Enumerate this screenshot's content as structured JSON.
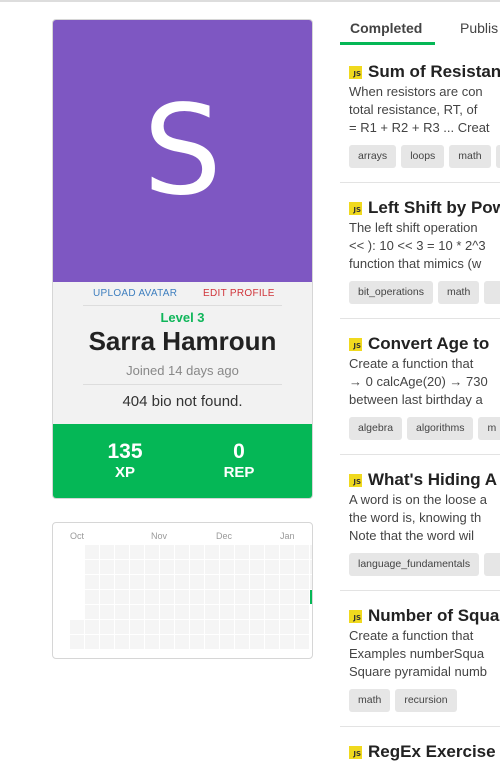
{
  "profile": {
    "avatar_letter": "S",
    "upload_avatar": "UPLOAD AVATAR",
    "edit_profile": "EDIT PROFILE",
    "level": "Level 3",
    "name": "Sarra Hamroun",
    "joined": "Joined 14 days ago",
    "bio": "404 bio not found.",
    "xp_value": "135",
    "xp_label": "XP",
    "rep_value": "0",
    "rep_label": "REP",
    "colors": {
      "avatar_bg": "#7e57c2",
      "stats_bg": "#05b756",
      "level": "#0fb65a"
    }
  },
  "activity": {
    "months": [
      "Oct",
      "Nov",
      "Dec",
      "Jan"
    ],
    "active_cells": 1
  },
  "tabs": [
    {
      "label": "Completed",
      "active": true
    },
    {
      "label": "Publis",
      "active": false
    }
  ],
  "katas": [
    {
      "language_icon": "JS",
      "title": "Sum of Resistanc",
      "description": [
        "When resistors are con",
        "total resistance, RT, of",
        "= R1 + R2 + R3 ... Creat"
      ],
      "tags": [
        "arrays",
        "loops",
        "math"
      ]
    },
    {
      "language_icon": "JS",
      "title": "Left Shift by Pow",
      "description": [
        "The left shift operation",
        "<< ): 10 << 3 = 10 * 2^3",
        "function that mimics (w"
      ],
      "tags": [
        "bit_operations",
        "math"
      ]
    },
    {
      "language_icon": "JS",
      "title": "Convert Age to",
      "description": [
        "Create a function that",
        "→ 0 calcAge(20) → 730",
        "between last birthday a"
      ],
      "tags": [
        "algebra",
        "algorithms",
        "m"
      ]
    },
    {
      "language_icon": "JS",
      "title": "What's Hiding A",
      "description": [
        "A word is on the loose a",
        "the word is, knowing th",
        "Note that the word wil"
      ],
      "tags": [
        "language_fundamentals"
      ]
    },
    {
      "language_icon": "JS",
      "title": "Number of Squa",
      "description": [
        "Create a function that",
        "Examples numberSqua",
        "Square pyramidal numb"
      ],
      "tags": [
        "math",
        "recursion"
      ]
    },
    {
      "language_icon": "JS",
      "title": "RegEx Exercise",
      "description": [],
      "tags": []
    }
  ]
}
